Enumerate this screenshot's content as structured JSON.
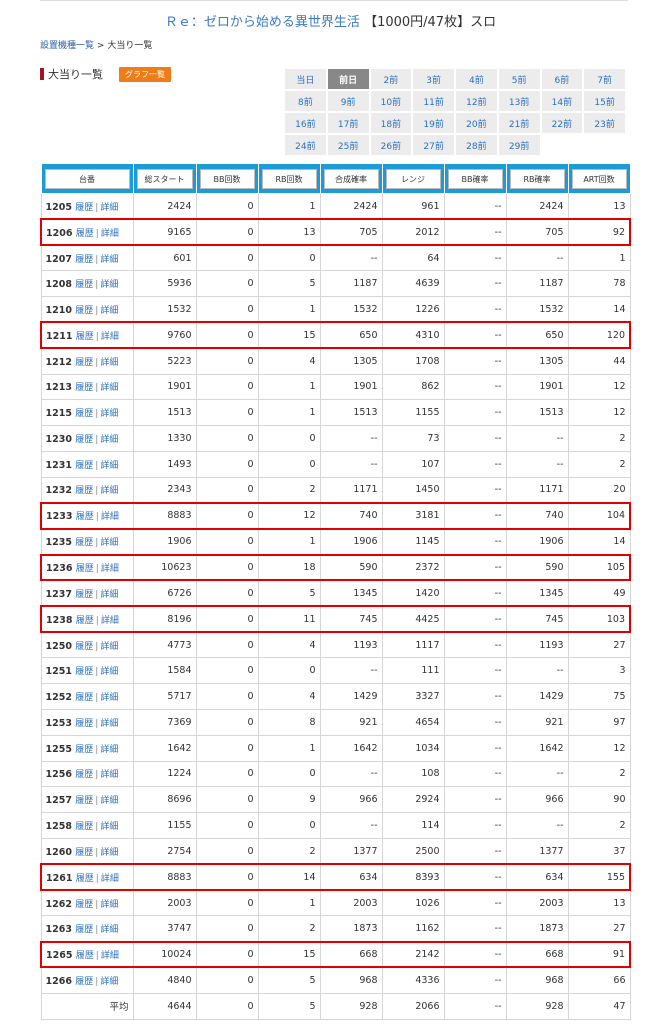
{
  "header": {
    "title_link": "Ｒｅ：ゼロから始める異世界生活",
    "title_rest": "【1000円/47枚】スロ",
    "breadcrumb_link": "設置機種一覧",
    "breadcrumb_sep": ">",
    "breadcrumb_current": "大当り一覧"
  },
  "section": {
    "title": "大当り一覧",
    "graph_button": "グラフ一覧"
  },
  "days": [
    "当日",
    "前日",
    "2前",
    "3前",
    "4前",
    "5前",
    "6前",
    "7前",
    "8前",
    "9前",
    "10前",
    "11前",
    "12前",
    "13前",
    "14前",
    "15前",
    "16前",
    "17前",
    "18前",
    "19前",
    "20前",
    "21前",
    "22前",
    "23前",
    "24前",
    "25前",
    "26前",
    "27前",
    "28前",
    "29前"
  ],
  "active_day": "前日",
  "columns": [
    "台番",
    "総スタート",
    "BB回数",
    "RB回数",
    "合成確率",
    "レンジ",
    "BB確率",
    "RB確率",
    "ART回数"
  ],
  "link_labels": {
    "history": "履歴",
    "detail": "詳細"
  },
  "accent_colors": {
    "header_blue": "#1c9bd8",
    "highlight_red": "#e00000",
    "graph_button": "#f07c17",
    "title_bar": "#a0142a"
  },
  "rows": [
    {
      "id": "1205",
      "start": "2424",
      "bb": "0",
      "rb": "1",
      "comb": "2424",
      "range": "961",
      "bbp": "--",
      "rbp": "2424",
      "art": "13",
      "hl": false
    },
    {
      "id": "1206",
      "start": "9165",
      "bb": "0",
      "rb": "13",
      "comb": "705",
      "range": "2012",
      "bbp": "--",
      "rbp": "705",
      "art": "92",
      "hl": true
    },
    {
      "id": "1207",
      "start": "601",
      "bb": "0",
      "rb": "0",
      "comb": "--",
      "range": "64",
      "bbp": "--",
      "rbp": "--",
      "art": "1",
      "hl": false
    },
    {
      "id": "1208",
      "start": "5936",
      "bb": "0",
      "rb": "5",
      "comb": "1187",
      "range": "4639",
      "bbp": "--",
      "rbp": "1187",
      "art": "78",
      "hl": false
    },
    {
      "id": "1210",
      "start": "1532",
      "bb": "0",
      "rb": "1",
      "comb": "1532",
      "range": "1226",
      "bbp": "--",
      "rbp": "1532",
      "art": "14",
      "hl": false
    },
    {
      "id": "1211",
      "start": "9760",
      "bb": "0",
      "rb": "15",
      "comb": "650",
      "range": "4310",
      "bbp": "--",
      "rbp": "650",
      "art": "120",
      "hl": true
    },
    {
      "id": "1212",
      "start": "5223",
      "bb": "0",
      "rb": "4",
      "comb": "1305",
      "range": "1708",
      "bbp": "--",
      "rbp": "1305",
      "art": "44",
      "hl": false
    },
    {
      "id": "1213",
      "start": "1901",
      "bb": "0",
      "rb": "1",
      "comb": "1901",
      "range": "862",
      "bbp": "--",
      "rbp": "1901",
      "art": "12",
      "hl": false
    },
    {
      "id": "1215",
      "start": "1513",
      "bb": "0",
      "rb": "1",
      "comb": "1513",
      "range": "1155",
      "bbp": "--",
      "rbp": "1513",
      "art": "12",
      "hl": false
    },
    {
      "id": "1230",
      "start": "1330",
      "bb": "0",
      "rb": "0",
      "comb": "--",
      "range": "73",
      "bbp": "--",
      "rbp": "--",
      "art": "2",
      "hl": false
    },
    {
      "id": "1231",
      "start": "1493",
      "bb": "0",
      "rb": "0",
      "comb": "--",
      "range": "107",
      "bbp": "--",
      "rbp": "--",
      "art": "2",
      "hl": false
    },
    {
      "id": "1232",
      "start": "2343",
      "bb": "0",
      "rb": "2",
      "comb": "1171",
      "range": "1450",
      "bbp": "--",
      "rbp": "1171",
      "art": "20",
      "hl": false
    },
    {
      "id": "1233",
      "start": "8883",
      "bb": "0",
      "rb": "12",
      "comb": "740",
      "range": "3181",
      "bbp": "--",
      "rbp": "740",
      "art": "104",
      "hl": true
    },
    {
      "id": "1235",
      "start": "1906",
      "bb": "0",
      "rb": "1",
      "comb": "1906",
      "range": "1145",
      "bbp": "--",
      "rbp": "1906",
      "art": "14",
      "hl": false
    },
    {
      "id": "1236",
      "start": "10623",
      "bb": "0",
      "rb": "18",
      "comb": "590",
      "range": "2372",
      "bbp": "--",
      "rbp": "590",
      "art": "105",
      "hl": true
    },
    {
      "id": "1237",
      "start": "6726",
      "bb": "0",
      "rb": "5",
      "comb": "1345",
      "range": "1420",
      "bbp": "--",
      "rbp": "1345",
      "art": "49",
      "hl": false
    },
    {
      "id": "1238",
      "start": "8196",
      "bb": "0",
      "rb": "11",
      "comb": "745",
      "range": "4425",
      "bbp": "--",
      "rbp": "745",
      "art": "103",
      "hl": true
    },
    {
      "id": "1250",
      "start": "4773",
      "bb": "0",
      "rb": "4",
      "comb": "1193",
      "range": "1117",
      "bbp": "--",
      "rbp": "1193",
      "art": "27",
      "hl": false
    },
    {
      "id": "1251",
      "start": "1584",
      "bb": "0",
      "rb": "0",
      "comb": "--",
      "range": "111",
      "bbp": "--",
      "rbp": "--",
      "art": "3",
      "hl": false
    },
    {
      "id": "1252",
      "start": "5717",
      "bb": "0",
      "rb": "4",
      "comb": "1429",
      "range": "3327",
      "bbp": "--",
      "rbp": "1429",
      "art": "75",
      "hl": false
    },
    {
      "id": "1253",
      "start": "7369",
      "bb": "0",
      "rb": "8",
      "comb": "921",
      "range": "4654",
      "bbp": "--",
      "rbp": "921",
      "art": "97",
      "hl": false
    },
    {
      "id": "1255",
      "start": "1642",
      "bb": "0",
      "rb": "1",
      "comb": "1642",
      "range": "1034",
      "bbp": "--",
      "rbp": "1642",
      "art": "12",
      "hl": false
    },
    {
      "id": "1256",
      "start": "1224",
      "bb": "0",
      "rb": "0",
      "comb": "--",
      "range": "108",
      "bbp": "--",
      "rbp": "--",
      "art": "2",
      "hl": false
    },
    {
      "id": "1257",
      "start": "8696",
      "bb": "0",
      "rb": "9",
      "comb": "966",
      "range": "2924",
      "bbp": "--",
      "rbp": "966",
      "art": "90",
      "hl": false
    },
    {
      "id": "1258",
      "start": "1155",
      "bb": "0",
      "rb": "0",
      "comb": "--",
      "range": "114",
      "bbp": "--",
      "rbp": "--",
      "art": "2",
      "hl": false
    },
    {
      "id": "1260",
      "start": "2754",
      "bb": "0",
      "rb": "2",
      "comb": "1377",
      "range": "2500",
      "bbp": "--",
      "rbp": "1377",
      "art": "37",
      "hl": false
    },
    {
      "id": "1261",
      "start": "8883",
      "bb": "0",
      "rb": "14",
      "comb": "634",
      "range": "8393",
      "bbp": "--",
      "rbp": "634",
      "art": "155",
      "hl": true
    },
    {
      "id": "1262",
      "start": "2003",
      "bb": "0",
      "rb": "1",
      "comb": "2003",
      "range": "1026",
      "bbp": "--",
      "rbp": "2003",
      "art": "13",
      "hl": false
    },
    {
      "id": "1263",
      "start": "3747",
      "bb": "0",
      "rb": "2",
      "comb": "1873",
      "range": "1162",
      "bbp": "--",
      "rbp": "1873",
      "art": "27",
      "hl": false
    },
    {
      "id": "1265",
      "start": "10024",
      "bb": "0",
      "rb": "15",
      "comb": "668",
      "range": "2142",
      "bbp": "--",
      "rbp": "668",
      "art": "91",
      "hl": true
    },
    {
      "id": "1266",
      "start": "4840",
      "bb": "0",
      "rb": "5",
      "comb": "968",
      "range": "4336",
      "bbp": "--",
      "rbp": "968",
      "art": "66",
      "hl": false
    }
  ],
  "average": {
    "label": "平均",
    "start": "4644",
    "bb": "0",
    "rb": "5",
    "comb": "928",
    "range": "2066",
    "bbp": "--",
    "rbp": "928",
    "art": "47"
  }
}
